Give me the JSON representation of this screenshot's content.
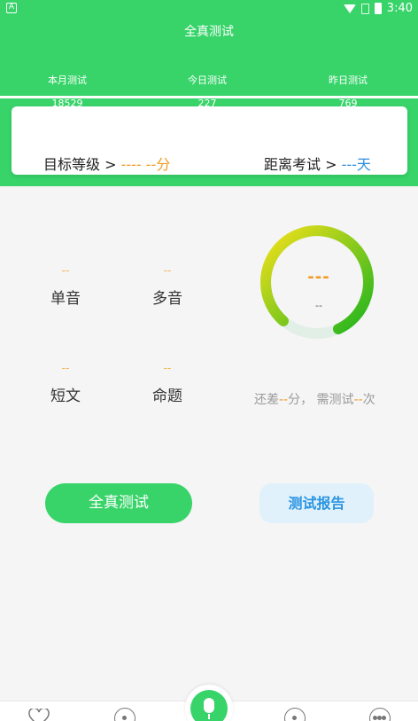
{
  "status_bar": {
    "left_badge": "A",
    "time": "3:40"
  },
  "header": {
    "title": "全真测试",
    "stats": [
      {
        "label": "本月测试",
        "value": "18529"
      },
      {
        "label": "今日测试",
        "value": "227"
      },
      {
        "label": "昨日测试",
        "value": "769"
      }
    ]
  },
  "goal_card": {
    "target_label": "目标等级 >",
    "target_value": "---- --分",
    "exam_label": "距离考试 >",
    "exam_value": "---天"
  },
  "categories": [
    {
      "name": "单音",
      "score": "--"
    },
    {
      "name": "多音",
      "score": "--"
    },
    {
      "name": "短文",
      "score": "--"
    },
    {
      "name": "命题",
      "score": "--"
    }
  ],
  "gauge": {
    "score": "---",
    "sub": "--",
    "colors": [
      "#f4e11a",
      "#1fb41f"
    ]
  },
  "remain": {
    "prefix": "还差",
    "points": "--",
    "mid": "分， 需测试",
    "times": "--",
    "suffix": "次"
  },
  "buttons": {
    "test_label": "全真测试",
    "report_label": "测试报告"
  },
  "tabbar": {
    "icons": [
      "heart-icon",
      "compass-icon",
      "mic-icon",
      "record-icon",
      "more-icon"
    ]
  },
  "colors": {
    "brand": "#38d46a",
    "accent_orange": "#f19a1f",
    "accent_blue": "#2b8fe0"
  }
}
